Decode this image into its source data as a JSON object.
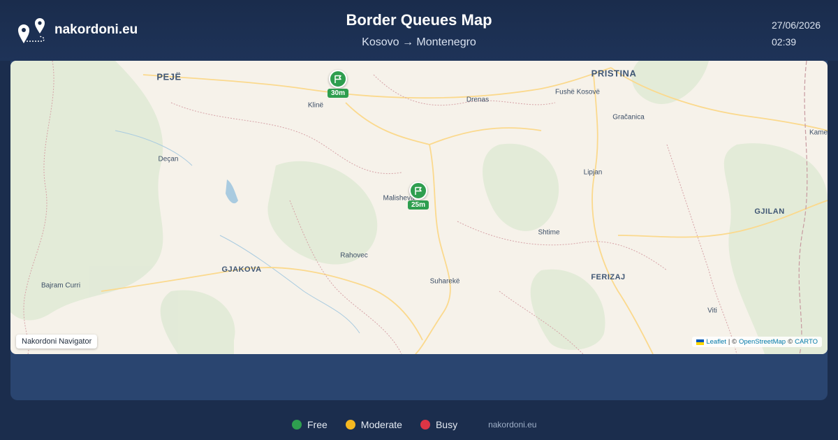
{
  "header": {
    "brand": "nakordoni.eu",
    "title": "Border Queues Map",
    "route": "Kosovo → Montenegro",
    "date": "27/06/2026",
    "time": "02:39"
  },
  "map": {
    "cities": [
      {
        "name": "PEJË",
        "major": true
      },
      {
        "name": "PRISTINA",
        "major": true
      },
      {
        "name": "Klinë",
        "major": false
      },
      {
        "name": "Drenas",
        "major": false
      },
      {
        "name": "Fushë Kosovë",
        "major": false
      },
      {
        "name": "Gračanica",
        "major": false
      },
      {
        "name": "Kame",
        "major": false
      },
      {
        "name": "Deçan",
        "major": false
      },
      {
        "name": "Lipjan",
        "major": false
      },
      {
        "name": "Malisheva",
        "major": false
      },
      {
        "name": "GJILAN",
        "major": true
      },
      {
        "name": "Shtime",
        "major": false
      },
      {
        "name": "Rahovec",
        "major": false
      },
      {
        "name": "GJAKOVA",
        "major": true
      },
      {
        "name": "FERIZAJ",
        "major": true
      },
      {
        "name": "Bajram Curri",
        "major": false
      },
      {
        "name": "Suharekë",
        "major": false
      },
      {
        "name": "Viti",
        "major": false
      }
    ],
    "markers": [
      {
        "wait": "30m",
        "status": "free",
        "icon": "flag-icon"
      },
      {
        "wait": "25m",
        "status": "free",
        "icon": "flag-icon"
      }
    ],
    "nav_label": "Nakordoni Navigator",
    "attribution": {
      "leaflet": "Leaflet",
      "sep1": "| ©",
      "osm": "OpenStreetMap",
      "sep2": "©",
      "carto": "CARTO"
    }
  },
  "legend": {
    "items": [
      {
        "label": "Free",
        "color": "#2e9e4f"
      },
      {
        "label": "Moderate",
        "color": "#f5b820"
      },
      {
        "label": "Busy",
        "color": "#dc3545"
      }
    ],
    "site": "nakordoni.eu"
  },
  "colors": {
    "header_bg": "#1a2c4c",
    "panel_bg": "#2a4570",
    "free": "#2e9e4f"
  }
}
